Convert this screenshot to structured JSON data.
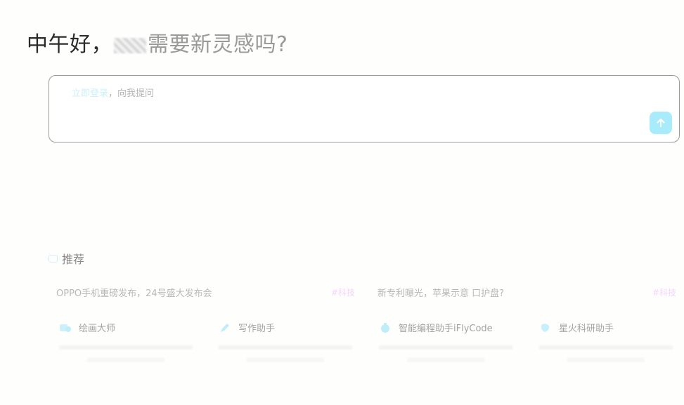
{
  "greeting": {
    "lead": "中午好，",
    "rest": "需要新灵感吗?"
  },
  "input": {
    "login_link": "立即登录",
    "prompt": "，向我提问"
  },
  "recommend": {
    "heading": "推荐",
    "news": [
      {
        "title": "OPPO手机重磅发布，24号盛大发布会",
        "tag": "#科技"
      },
      {
        "title": "新专利曝光，苹果示意 口护盘?",
        "tag": "#科技"
      }
    ],
    "tools": [
      {
        "name": "绘画大师",
        "icon": "paint-icon"
      },
      {
        "name": "写作助手",
        "icon": "pen-icon"
      },
      {
        "name": "智能编程助手iFlyCode",
        "icon": "code-icon"
      },
      {
        "name": "星火科研助手",
        "icon": "research-icon"
      }
    ]
  },
  "colors": {
    "accent": "#a8ecfb",
    "tag": "#f3d7fb"
  }
}
